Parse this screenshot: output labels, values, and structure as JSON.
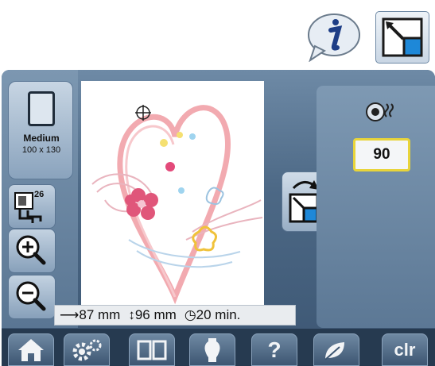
{
  "hoop": {
    "name": "Medium",
    "size": "100 x 130"
  },
  "stitch_count_label": "26",
  "status": {
    "width": "87 mm",
    "height": "96 mm",
    "time": "20 min."
  },
  "value_box": "90",
  "bottom_nav": {
    "help_label": "?",
    "clear_label": "clr"
  },
  "colors": {
    "screen": "#46627f",
    "highlight": "#e8d43a",
    "heart": "#f2aab0"
  }
}
